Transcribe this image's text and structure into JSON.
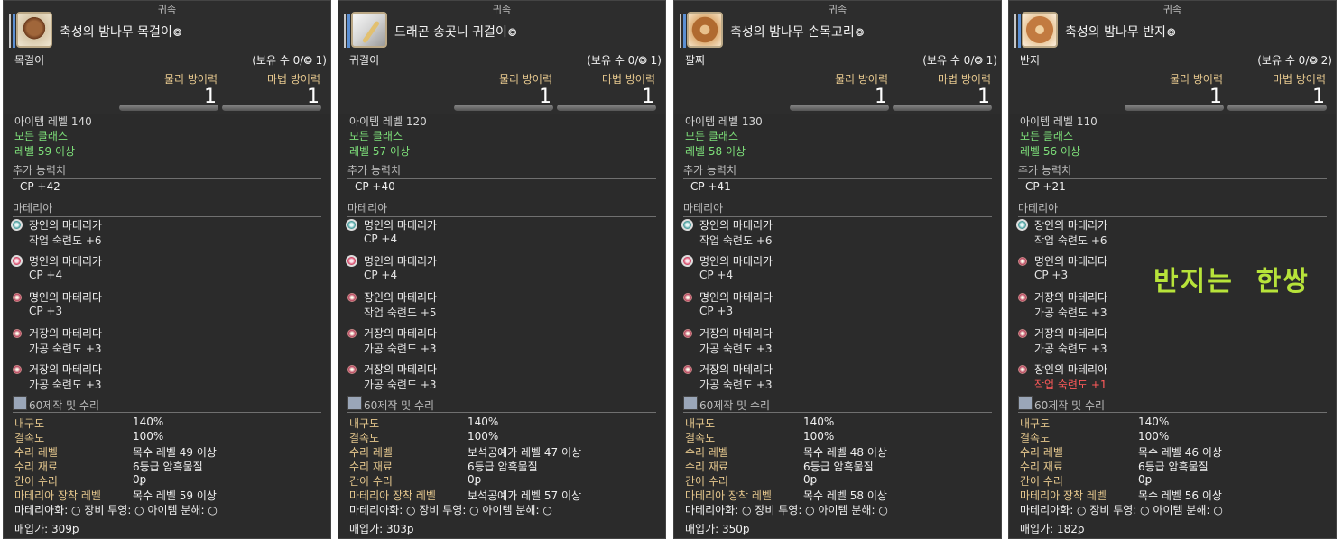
{
  "panels": [
    {
      "bound_label": "귀속",
      "icon": "ebony-necklace-icon",
      "item_name": "축성의 밤나무 목걸이",
      "hq_symbol": "⭗",
      "category": "목걸이",
      "owned": "(보유 수 0/⭗ 1)",
      "def_phys_label": "물리 방어력",
      "def_phys_value": "1",
      "def_mag_label": "마법 방어력",
      "def_mag_value": "1",
      "item_level": "아이템 레벨 140",
      "classes": "모든 클래스",
      "level_req": "레벨 59 이상",
      "bonus_header": "추가 능력치",
      "bonus_stat": "CP +42",
      "materia_header": "마테리아",
      "materia": [
        {
          "name": "장인의 마테리가",
          "value": "작업 숙련도 +6",
          "dot": "craft"
        },
        {
          "name": "명인의 마테리가",
          "value": "CP +4",
          "dot": "ctrl"
        },
        {
          "name": "명인의 마테리다",
          "value": "CP +3",
          "dot": "small"
        },
        {
          "name": "거장의 마테리다",
          "value": "가공 숙련도 +3",
          "dot": "small"
        },
        {
          "name": "거장의 마테리다",
          "value": "가공 숙련도 +3",
          "dot": "small"
        }
      ],
      "repair_header": "60제작 및 수리",
      "rows": [
        {
          "label": "내구도",
          "value": "140%"
        },
        {
          "label": "결속도",
          "value": "100%"
        },
        {
          "label": "수리 레벨",
          "value": "목수 레벨 49 이상"
        },
        {
          "label": "수리 재료",
          "value": "6등급 암흑물질"
        },
        {
          "label": "간이 수리",
          "value": "0ꝑ"
        },
        {
          "label": "마테리아 장착 레벨",
          "value": "목수 레벨 59 이상"
        }
      ],
      "flags": "마테리아화: ○ 장비 투영: ○ 아이템 분해: ○",
      "price": "매입가: 309ꝑ"
    },
    {
      "bound_label": "귀속",
      "icon": "dragon-fang-earring-icon",
      "item_name": "드래곤 송곳니 귀걸이",
      "hq_symbol": "⭗",
      "category": "귀걸이",
      "owned": "(보유 수 0/⭗ 1)",
      "def_phys_label": "물리 방어력",
      "def_phys_value": "1",
      "def_mag_label": "마법 방어력",
      "def_mag_value": "1",
      "item_level": "아이템 레벨 120",
      "classes": "모든 클래스",
      "level_req": "레벨 57 이상",
      "bonus_header": "추가 능력치",
      "bonus_stat": "CP +40",
      "materia_header": "마테리아",
      "materia": [
        {
          "name": "명인의 마테리가",
          "value": "CP +4",
          "dot": "craft"
        },
        {
          "name": "명인의 마테리가",
          "value": "CP +4",
          "dot": "ctrl"
        },
        {
          "name": "장인의 마테리다",
          "value": "작업 숙련도 +5",
          "dot": "small"
        },
        {
          "name": "거장의 마테리다",
          "value": "가공 숙련도 +3",
          "dot": "small"
        },
        {
          "name": "거장의 마테리다",
          "value": "가공 숙련도 +3",
          "dot": "small"
        }
      ],
      "repair_header": "60제작 및 수리",
      "rows": [
        {
          "label": "내구도",
          "value": "140%"
        },
        {
          "label": "결속도",
          "value": "100%"
        },
        {
          "label": "수리 레벨",
          "value": "보석공예가 레벨 47 이상"
        },
        {
          "label": "수리 재료",
          "value": "6등급 암흑물질"
        },
        {
          "label": "간이 수리",
          "value": "0ꝑ"
        },
        {
          "label": "마테리아 장착 레벨",
          "value": "보석공예가 레벨 57 이상"
        }
      ],
      "flags": "마테리아화: ○ 장비 투영: ○ 아이템 분해: ○",
      "price": "매입가: 303ꝑ"
    },
    {
      "bound_label": "귀속",
      "icon": "ebony-bracelet-icon",
      "item_name": "축성의 밤나무 손목고리",
      "hq_symbol": "⭗",
      "category": "팔찌",
      "owned": "(보유 수 0/⭗ 1)",
      "def_phys_label": "물리 방어력",
      "def_phys_value": "1",
      "def_mag_label": "마법 방어력",
      "def_mag_value": "1",
      "item_level": "아이템 레벨 130",
      "classes": "모든 클래스",
      "level_req": "레벨 58 이상",
      "bonus_header": "추가 능력치",
      "bonus_stat": "CP +41",
      "materia_header": "마테리아",
      "materia": [
        {
          "name": "장인의 마테리가",
          "value": "작업 숙련도 +6",
          "dot": "craft"
        },
        {
          "name": "명인의 마테리가",
          "value": "CP +4",
          "dot": "ctrl"
        },
        {
          "name": "명인의 마테리다",
          "value": "CP +3",
          "dot": "small"
        },
        {
          "name": "거장의 마테리다",
          "value": "가공 숙련도 +3",
          "dot": "small"
        },
        {
          "name": "거장의 마테리다",
          "value": "가공 숙련도 +3",
          "dot": "small"
        }
      ],
      "repair_header": "60제작 및 수리",
      "rows": [
        {
          "label": "내구도",
          "value": "140%"
        },
        {
          "label": "결속도",
          "value": "100%"
        },
        {
          "label": "수리 레벨",
          "value": "목수 레벨 48 이상"
        },
        {
          "label": "수리 재료",
          "value": "6등급 암흑물질"
        },
        {
          "label": "간이 수리",
          "value": "0ꝑ"
        },
        {
          "label": "마테리아 장착 레벨",
          "value": "목수 레벨 58 이상"
        }
      ],
      "flags": "마테리아화: ○ 장비 투영: ○ 아이템 분해: ○",
      "price": "매입가: 350ꝑ"
    },
    {
      "bound_label": "귀속",
      "icon": "ebony-ring-icon",
      "item_name": "축성의 밤나무 반지",
      "hq_symbol": "⭗",
      "category": "반지",
      "owned": "(보유 수 0/⭗ 2)",
      "def_phys_label": "물리 방어력",
      "def_phys_value": "1",
      "def_mag_label": "마법 방어력",
      "def_mag_value": "1",
      "item_level": "아이템 레벨 110",
      "classes": "모든 클래스",
      "level_req": "레벨 56 이상",
      "bonus_header": "추가 능력치",
      "bonus_stat": "CP +21",
      "materia_header": "마테리아",
      "materia": [
        {
          "name": "장인의 마테리가",
          "value": "작업 숙련도 +6",
          "dot": "craft"
        },
        {
          "name": "명인의 마테리다",
          "value": "CP +3",
          "dot": "small"
        },
        {
          "name": "거장의 마테리다",
          "value": "가공 숙련도 +3",
          "dot": "small"
        },
        {
          "name": "거장의 마테리다",
          "value": "가공 숙련도 +3",
          "dot": "small"
        },
        {
          "name": "장인의 마테리아",
          "value": "작업 숙련도 +1",
          "dot": "small",
          "red": true
        }
      ],
      "repair_header": "60제작 및 수리",
      "rows": [
        {
          "label": "내구도",
          "value": "140%"
        },
        {
          "label": "결속도",
          "value": "100%"
        },
        {
          "label": "수리 레벨",
          "value": "목수 레벨 46 이상"
        },
        {
          "label": "수리 재료",
          "value": "6등급 암흑물질"
        },
        {
          "label": "간이 수리",
          "value": "0ꝑ"
        },
        {
          "label": "마테리아 장착 레벨",
          "value": "목수 레벨 56 이상"
        }
      ],
      "flags": "마테리아화: ○ 장비 투영: ○ 아이템 분해: ○",
      "price": "매입가: 182ꝑ"
    }
  ],
  "annotation": "반지는  한쌍",
  "colors": {
    "panel_bg": "#2d2d2d",
    "green": "#7ee07a",
    "gold": "#e6c88e",
    "annotation": "#b7e33a",
    "red": "#ff5a5a"
  }
}
